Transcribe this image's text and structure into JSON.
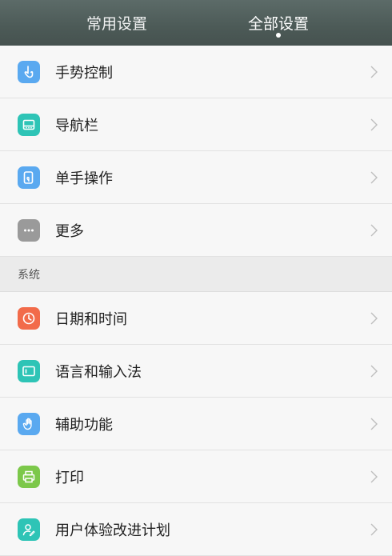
{
  "tabs": {
    "common_label": "常用设置",
    "all_label": "全部设置"
  },
  "group1": [
    {
      "label": "手势控制",
      "icon": "gesture-icon",
      "color": "#5aa9f0"
    },
    {
      "label": "导航栏",
      "icon": "navigation-bar-icon",
      "color": "#2ec4b6"
    },
    {
      "label": "单手操作",
      "icon": "one-hand-icon",
      "color": "#5aa9f0"
    },
    {
      "label": "更多",
      "icon": "more-icon",
      "color": "#9a9a9a"
    }
  ],
  "section_title": "系统",
  "group2": [
    {
      "label": "日期和时间",
      "icon": "clock-icon",
      "color": "#f26b4a"
    },
    {
      "label": "语言和输入法",
      "icon": "keyboard-icon",
      "color": "#2ec4b6"
    },
    {
      "label": "辅助功能",
      "icon": "hand-icon",
      "color": "#5aa9f0"
    },
    {
      "label": "打印",
      "icon": "printer-icon",
      "color": "#7cc84a"
    },
    {
      "label": "用户体验改进计划",
      "icon": "user-experience-icon",
      "color": "#2ec4b6"
    }
  ]
}
